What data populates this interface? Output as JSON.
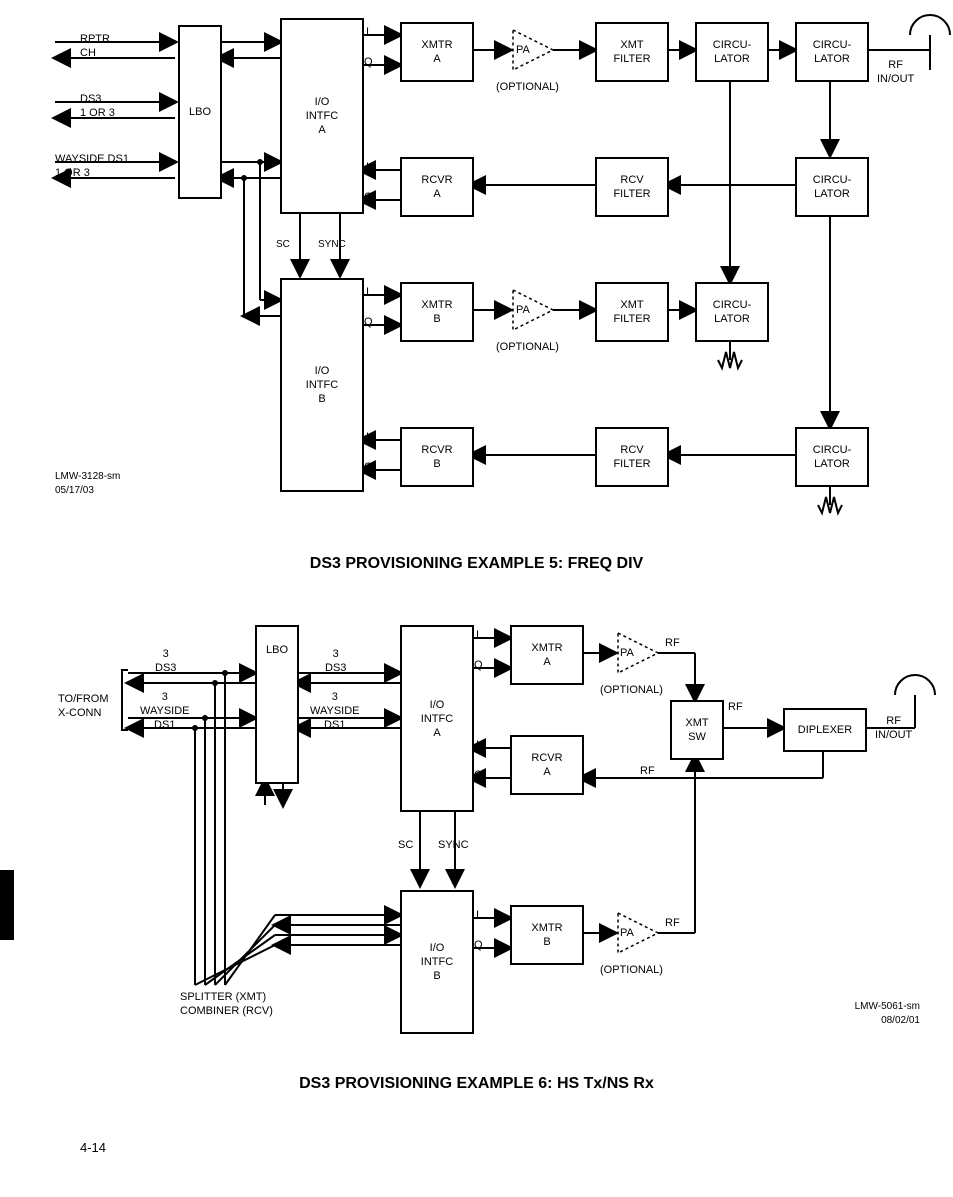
{
  "diagram1": {
    "lbo": "LBO",
    "io_a": "I/O\nINTFC\nA",
    "io_b": "I/O\nINTFC\nB",
    "xmtr_a": "XMTR\nA",
    "rcvr_a": "RCVR\nA",
    "xmtr_b": "XMTR\nB",
    "rcvr_b": "RCVR\nB",
    "pa": "PA",
    "optional": "(OPTIONAL)",
    "xmt_filter": "XMT\nFILTER",
    "rcv_filter": "RCV\nFILTER",
    "circulator": "CIRCU-\nLATOR",
    "rf_inout": "RF\nIN/OUT",
    "sc": "SC",
    "sync": "SYNC",
    "i": "I",
    "q": "Q",
    "rptr": "RPTR\nCH",
    "ds3": "DS3\n1 OR 3",
    "wayside": "WAYSIDE DS1\n1 OR 3",
    "doc": "LMW-3128-sm\n05/17/03"
  },
  "cap1": "DS3 PROVISIONING EXAMPLE 5:   FREQ DIV",
  "diagram2": {
    "lbo": "LBO",
    "io_a": "I/O\nINTFC\nA",
    "io_b": "I/O\nINTFC\nB",
    "xmtr_a": "XMTR\nA",
    "rcvr_a": "RCVR\nA",
    "xmtr_b": "XMTR\nB",
    "pa": "PA",
    "optional": "(OPTIONAL)",
    "xmt_sw": "XMT\nSW",
    "diplexer": "DIPLEXER",
    "rf_inout": "RF\nIN/OUT",
    "rf": "RF",
    "sc": "SC",
    "sync": "SYNC",
    "i": "I",
    "q": "Q",
    "to_from": "TO/FROM\nX-CONN",
    "three_ds3": "3\nDS3",
    "three_ws": "3\nWAYSIDE\nDS1",
    "splitter": "SPLITTER (XMT)\nCOMBINER (RCV)",
    "doc": "LMW-5061-sm\n08/02/01"
  },
  "cap2": "DS3 PROVISIONING EXAMPLE 6:   HS Tx/NS Rx",
  "pagenum": "4-14"
}
